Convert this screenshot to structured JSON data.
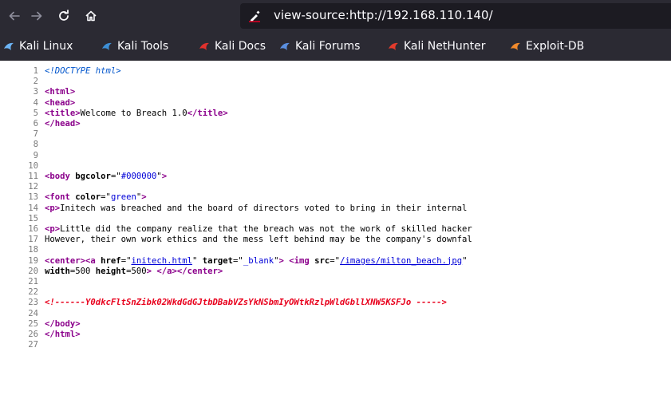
{
  "browser": {
    "url": "view-source:http://192.168.110.140/",
    "bookmarks": [
      {
        "label": "Kali Linux",
        "icon": "kali-dragon-icon",
        "color": "#6cb4f5"
      },
      {
        "label": "Kali Tools",
        "icon": "kali-tools-icon",
        "color": "#3d8fd6"
      },
      {
        "label": "Kali Docs",
        "icon": "kali-docs-icon",
        "color": "#e0312d"
      },
      {
        "label": "Kali Forums",
        "icon": "kali-forums-icon",
        "color": "#5a8fe0"
      },
      {
        "label": "Kali NetHunter",
        "icon": "nethunter-icon",
        "color": "#e23b2c"
      },
      {
        "label": "Exploit-DB",
        "icon": "exploit-db-icon",
        "color": "#f18a2c"
      }
    ]
  },
  "source": {
    "lines": [
      {
        "n": "1",
        "parts": [
          {
            "c": "doctype",
            "t": "<!DOCTYPE html>"
          }
        ]
      },
      {
        "n": "2",
        "parts": []
      },
      {
        "n": "3",
        "parts": [
          {
            "c": "t",
            "t": "<html>"
          }
        ]
      },
      {
        "n": "4",
        "parts": [
          {
            "c": "t",
            "t": "<head>"
          }
        ]
      },
      {
        "n": "5",
        "parts": [
          {
            "c": "t",
            "t": "<title>"
          },
          {
            "c": "",
            "t": "Welcome to Breach 1.0"
          },
          {
            "c": "t",
            "t": "</title>"
          }
        ]
      },
      {
        "n": "6",
        "parts": [
          {
            "c": "t",
            "t": "</head>"
          }
        ]
      },
      {
        "n": "7",
        "parts": []
      },
      {
        "n": "8",
        "parts": []
      },
      {
        "n": "9",
        "parts": []
      },
      {
        "n": "10",
        "parts": []
      },
      {
        "n": "11",
        "parts": [
          {
            "c": "t",
            "t": "<body "
          },
          {
            "c": "an",
            "t": "bgcolor"
          },
          {
            "c": "",
            "t": "=\""
          },
          {
            "c": "av",
            "t": "#000000"
          },
          {
            "c": "",
            "t": "\""
          },
          {
            "c": "t",
            "t": ">"
          }
        ]
      },
      {
        "n": "12",
        "parts": []
      },
      {
        "n": "13",
        "parts": [
          {
            "c": "t",
            "t": "<font "
          },
          {
            "c": "an",
            "t": "color"
          },
          {
            "c": "",
            "t": "=\""
          },
          {
            "c": "av",
            "t": "green"
          },
          {
            "c": "",
            "t": "\""
          },
          {
            "c": "t",
            "t": ">"
          }
        ]
      },
      {
        "n": "14",
        "parts": [
          {
            "c": "t",
            "t": "<p>"
          },
          {
            "c": "",
            "t": "Initech was breached and the board of directors voted to bring in their internal"
          }
        ]
      },
      {
        "n": "15",
        "parts": []
      },
      {
        "n": "16",
        "parts": [
          {
            "c": "t",
            "t": "<p>"
          },
          {
            "c": "",
            "t": "Little did the company realize that the breach was not the work of skilled hacker"
          }
        ]
      },
      {
        "n": "17",
        "parts": [
          {
            "c": "",
            "t": "However, their own work ethics and the mess left behind may be the company's downfal"
          }
        ]
      },
      {
        "n": "18",
        "parts": []
      },
      {
        "n": "19",
        "parts": [
          {
            "c": "t",
            "t": "<center><a "
          },
          {
            "c": "an",
            "t": "href"
          },
          {
            "c": "",
            "t": "=\""
          },
          {
            "c": "lnk",
            "t": "initech.html"
          },
          {
            "c": "",
            "t": "\" "
          },
          {
            "c": "an",
            "t": "target"
          },
          {
            "c": "",
            "t": "=\""
          },
          {
            "c": "av",
            "t": "_blank"
          },
          {
            "c": "",
            "t": "\""
          },
          {
            "c": "t",
            "t": ">"
          },
          {
            "c": "",
            "t": " "
          },
          {
            "c": "t",
            "t": "<img "
          },
          {
            "c": "an",
            "t": "src"
          },
          {
            "c": "",
            "t": "=\""
          },
          {
            "c": "lnk",
            "t": "/images/milton_beach.jpg"
          },
          {
            "c": "",
            "t": "\""
          }
        ]
      },
      {
        "n": "20",
        "parts": [
          {
            "c": "an",
            "t": "width"
          },
          {
            "c": "",
            "t": "=500 "
          },
          {
            "c": "an",
            "t": "height"
          },
          {
            "c": "",
            "t": "=500"
          },
          {
            "c": "t",
            "t": ">"
          },
          {
            "c": "",
            "t": " "
          },
          {
            "c": "t",
            "t": "</a></center>"
          }
        ]
      },
      {
        "n": "21",
        "parts": []
      },
      {
        "n": "22",
        "parts": []
      },
      {
        "n": "23",
        "parts": [
          {
            "c": "cm",
            "t": "<!------Y0dkcFltSnZibk02WkdGdGJtbDBabVZsYkNSbmIyOWtkRzlpWldGbllXNW5KSFJo ----->"
          }
        ]
      },
      {
        "n": "24",
        "parts": []
      },
      {
        "n": "25",
        "parts": [
          {
            "c": "t",
            "t": "</body>"
          }
        ]
      },
      {
        "n": "26",
        "parts": [
          {
            "c": "t",
            "t": "</html>"
          }
        ]
      },
      {
        "n": "27",
        "parts": []
      }
    ]
  }
}
